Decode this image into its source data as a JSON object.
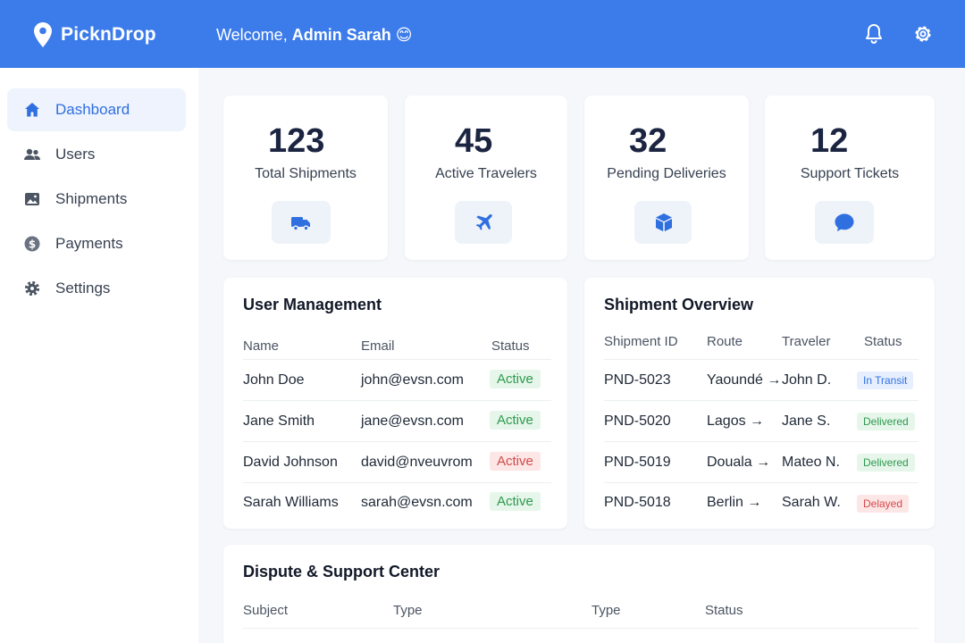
{
  "header": {
    "app_name": "PicknDrop",
    "welcome_prefix": "Welcome, ",
    "welcome_name": "Admin Sarah",
    "welcome_emoji": "😊"
  },
  "sidebar": {
    "items": [
      {
        "label": "Dashboard",
        "icon": "home-icon",
        "active": true
      },
      {
        "label": "Users",
        "icon": "users-icon"
      },
      {
        "label": "Shipments",
        "icon": "image-icon"
      },
      {
        "label": "Payments",
        "icon": "dollar-icon"
      },
      {
        "label": "Settings",
        "icon": "gear-icon"
      }
    ]
  },
  "stats": [
    {
      "value": "123",
      "label": "Total Shipments",
      "icon": "truck-icon"
    },
    {
      "value": "45",
      "label": "Active Travelers",
      "icon": "plane-icon"
    },
    {
      "value": "32",
      "label": "Pending Deliveries",
      "icon": "box-icon"
    },
    {
      "value": "12",
      "label": "Support Tickets",
      "icon": "chat-icon"
    }
  ],
  "user_management": {
    "title": "User Management",
    "columns": [
      "Name",
      "Email",
      "Status"
    ],
    "rows": [
      {
        "name": "John Doe",
        "email": "john@evsn.com",
        "status": "Active",
        "tone": "green"
      },
      {
        "name": "Jane Smith",
        "email": "jane@evsn.com",
        "status": "Active",
        "tone": "green"
      },
      {
        "name": "David Johnson",
        "email": "david@nveuvrom",
        "status": "Active",
        "tone": "red"
      },
      {
        "name": "Sarah Williams",
        "email": "sarah@evsn.com",
        "status": "Active",
        "tone": "green"
      }
    ]
  },
  "shipment_overview": {
    "title": "Shipment Overview",
    "columns": [
      "Shipment ID",
      "Route",
      "Traveler",
      "Status"
    ],
    "rows": [
      {
        "id": "PND-5023",
        "route": "Yaoundé →",
        "traveler": "John D.",
        "status": "In Transit",
        "tone": "blue"
      },
      {
        "id": "PND-5020",
        "route": "Lagos →",
        "traveler": "Jane S.",
        "status": "Delivered",
        "tone": "green"
      },
      {
        "id": "PND-5019",
        "route": "Douala →",
        "traveler": "Mateo N.",
        "status": "Delivered",
        "tone": "green"
      },
      {
        "id": "PND-5018",
        "route": "Berlin →",
        "traveler": "Sarah W.",
        "status": "Delayed",
        "tone": "red"
      }
    ]
  },
  "dispute_center": {
    "title": "Dispute & Support Center",
    "columns": [
      "Subject",
      "Type",
      "Type",
      "Status"
    ]
  },
  "colors": {
    "primary": "#3b7bea",
    "active_green": "#2d9a4e",
    "alert_red": "#d24a4a"
  }
}
